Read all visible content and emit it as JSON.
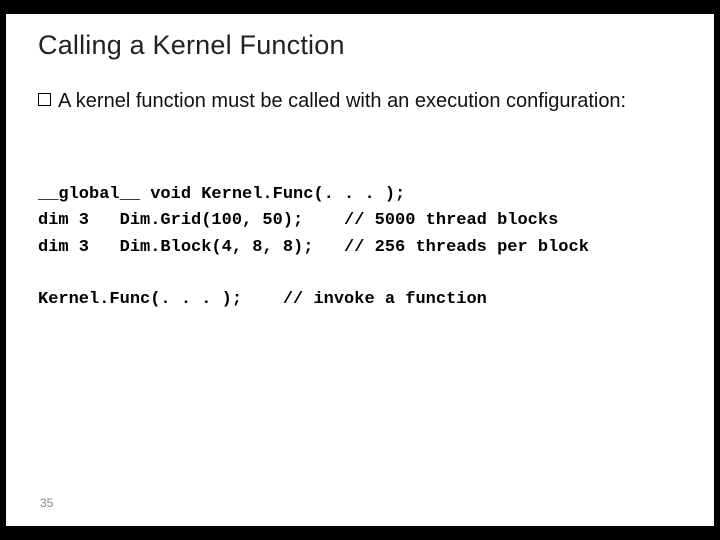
{
  "slide": {
    "title": "Calling a Kernel Function",
    "bullet_text": "A kernel function must be called with an execution configuration:",
    "page_number": "35"
  },
  "code": {
    "line1": "__global__ void Kernel.Func(. . . );",
    "line2": "dim 3   Dim.Grid(100, 50);    // 5000 thread blocks",
    "line3": "dim 3   Dim.Block(4, 8, 8);   // 256 threads per block",
    "blank": "",
    "line4": "Kernel.Func(. . . );    // invoke a function"
  }
}
